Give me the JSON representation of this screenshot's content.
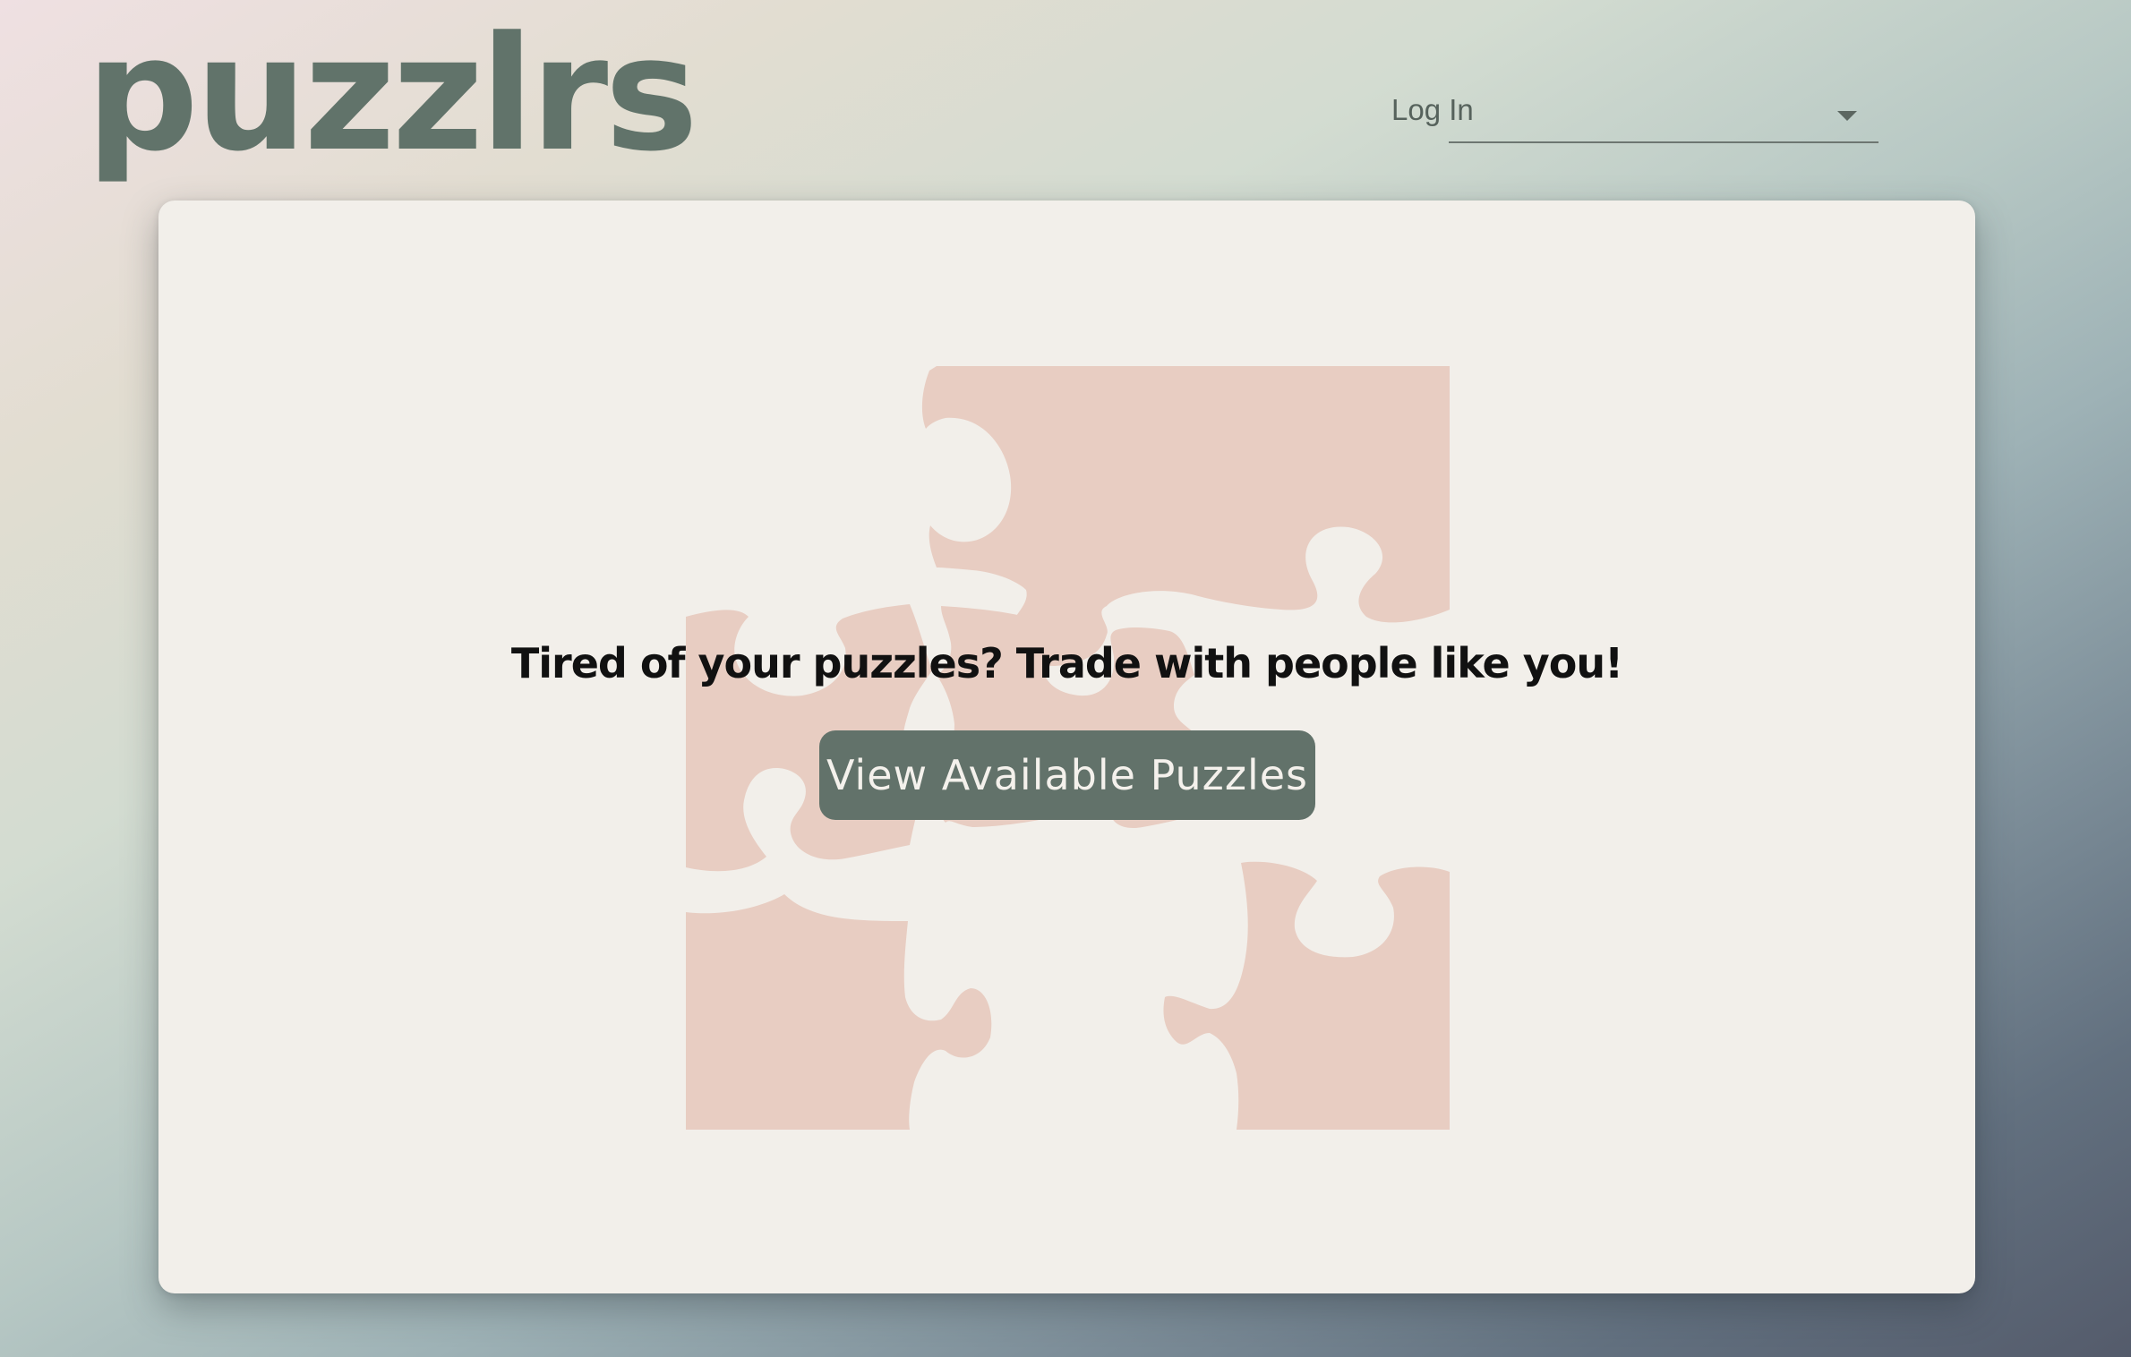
{
  "header": {
    "logo_text": "puzzlrs",
    "login_select_value": "Log In"
  },
  "hero": {
    "tagline": "Tired of your puzzles? Trade with people like you!",
    "cta_label": "View Available Puzzles"
  },
  "colors": {
    "brand_green": "#62726a",
    "puzzle_pink": "#e8cdc2",
    "card_background": "#f2efea"
  },
  "icons": {
    "login_dropdown": "caret-down-icon",
    "hero_illustration": "jigsaw-puzzle-illustration"
  }
}
